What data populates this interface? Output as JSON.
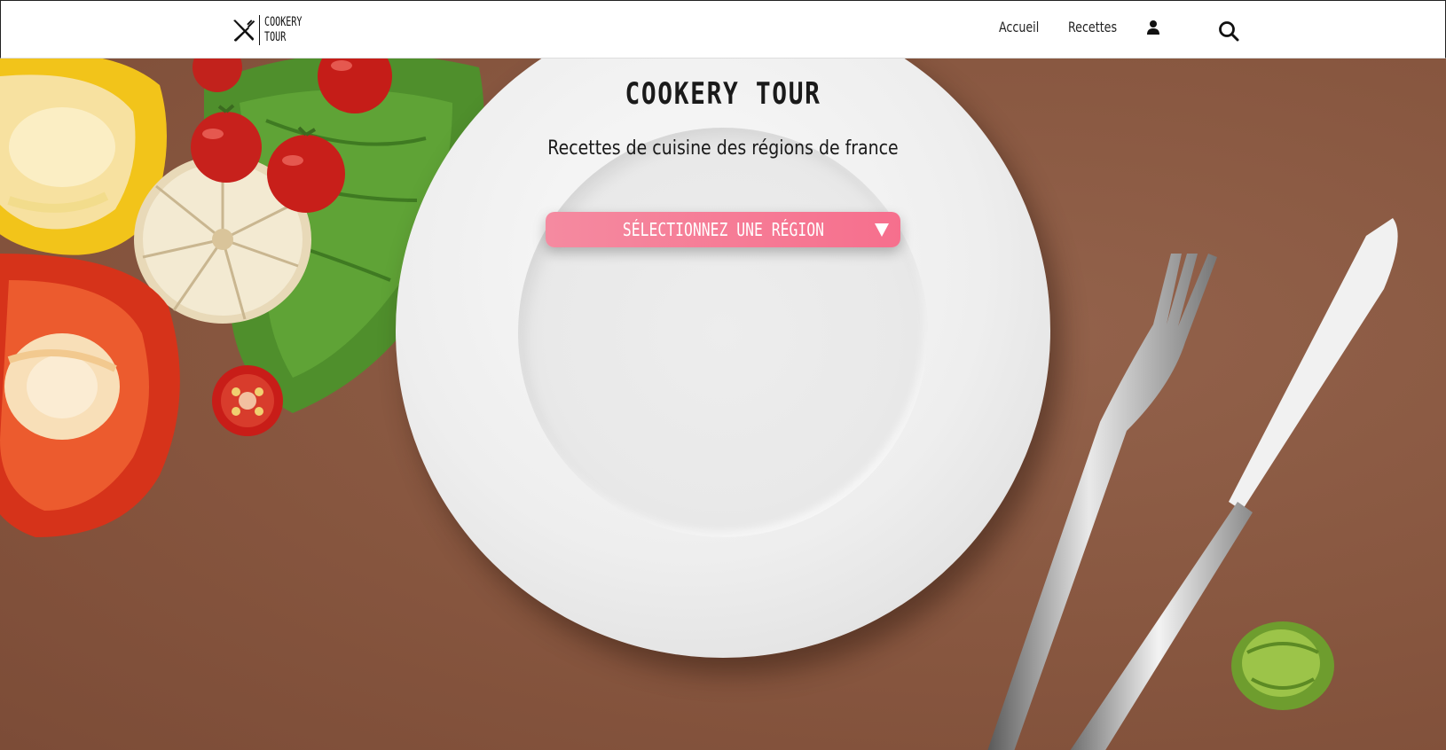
{
  "header": {
    "logo_line1": "COOKERY",
    "logo_line2": "TOUR",
    "nav": [
      {
        "label": "Accueil"
      },
      {
        "label": "Recettes"
      }
    ],
    "icons": [
      "user-icon",
      "search-icon"
    ]
  },
  "hero": {
    "title": "COOKERY TOUR",
    "subtitle": "Recettes de cuisine des régions de france",
    "region_select": {
      "label": "SÉLECTIONNEZ UNE RÉGION",
      "icon": "triangle-down-icon"
    }
  },
  "colors": {
    "header_bg": "#ffffff",
    "background": "#87563f",
    "select_gradient_start": "#f58aa0",
    "select_gradient_end": "#f66f8d"
  }
}
